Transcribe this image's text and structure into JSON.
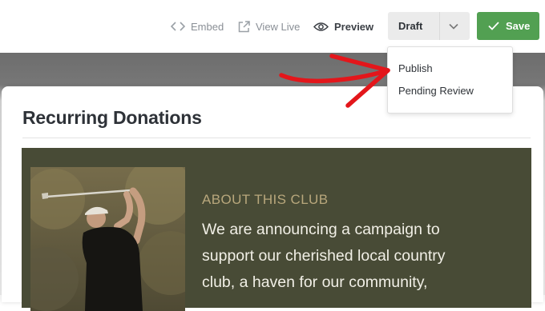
{
  "toolbar": {
    "embed_label": "Embed",
    "view_live_label": "View Live",
    "preview_label": "Preview",
    "status_value": "Draft",
    "save_label": "Save"
  },
  "status_menu": {
    "options": [
      "Publish",
      "Pending Review"
    ]
  },
  "form": {
    "title": "Recurring Donations",
    "hero": {
      "eyebrow": "ABOUT THIS CLUB",
      "text": "We are announcing a campaign to support our cherished local country club, a haven for our community,"
    }
  },
  "colors": {
    "save_button": "#52a052",
    "hero_background": "#484b36",
    "hero_eyebrow": "#b8a77c",
    "annotation_arrow": "#e3161b"
  },
  "icons": {
    "embed": "code-brackets-icon",
    "view_live": "external-link-icon",
    "preview": "eye-icon",
    "status": "chevron-down-icon",
    "save": "checkmark-icon"
  }
}
